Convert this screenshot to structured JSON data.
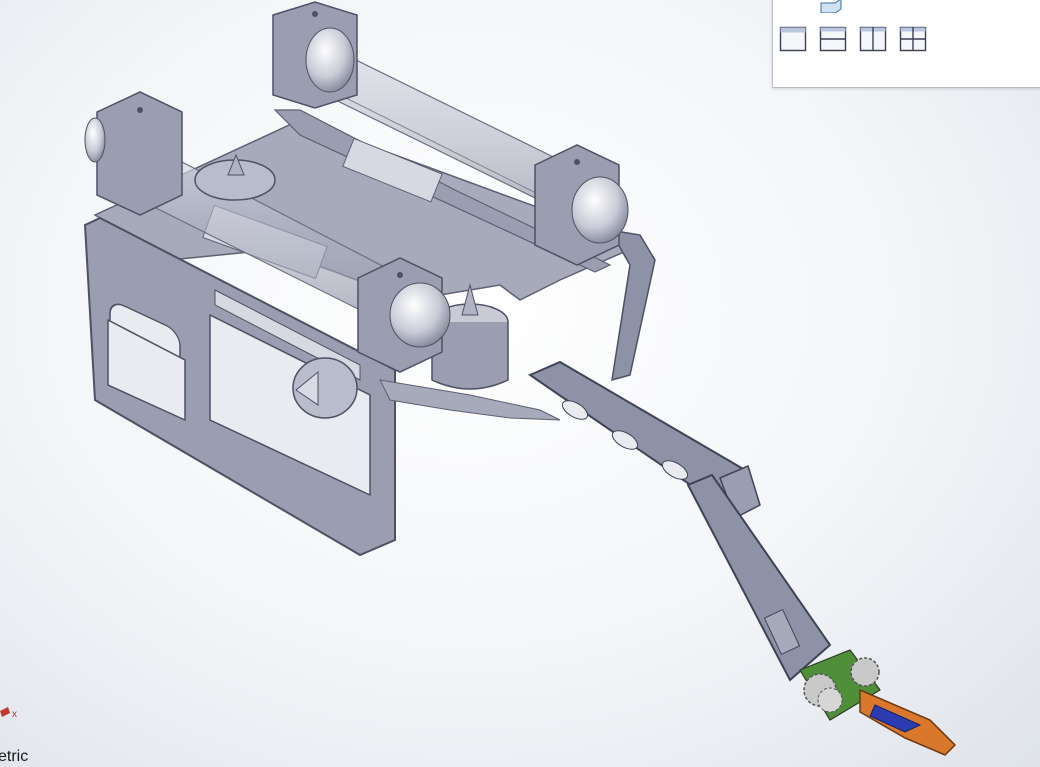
{
  "viewport": {
    "name": "rov-assembly-model",
    "colors": {
      "frame": "#9a9eb0",
      "frame_dark": "#5c6072",
      "tube": "#b8bcc9",
      "arm": "#8e92a6",
      "gripper": "#d9782a",
      "gear": "#c9c9c9",
      "board": "#4f8f3a"
    }
  },
  "view_panel": {
    "buttons": [
      {
        "icon": "single-view-icon"
      },
      {
        "icon": "two-view-horizontal-icon"
      },
      {
        "icon": "two-view-vertical-icon"
      },
      {
        "icon": "four-view-icon"
      }
    ]
  },
  "orientation": {
    "label": "etric",
    "triad_axis": "x"
  }
}
